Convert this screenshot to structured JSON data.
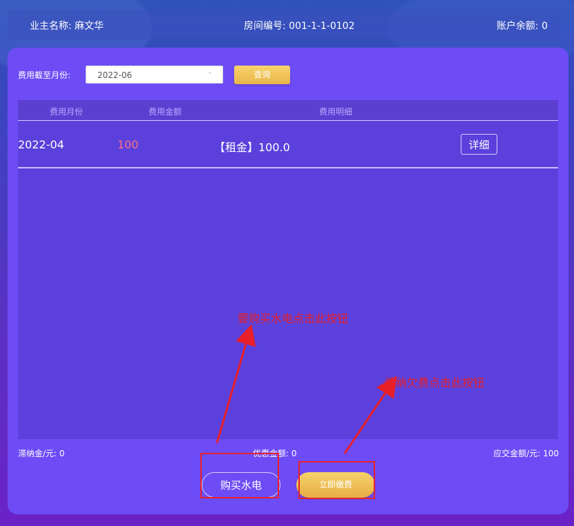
{
  "header": {
    "owner_name": "业主名称: 麻文华",
    "room_number": "房间编号: 001-1-1-0102",
    "account_balance": "账户余额: 0"
  },
  "filter": {
    "label": "费用截至月份:",
    "selected_month": "2022-06",
    "query_label": "查询"
  },
  "table": {
    "columns": [
      "费用月份",
      "费用金额",
      "费用明细"
    ],
    "rows": [
      {
        "month": "2022-04",
        "amount": "100",
        "detail": "【租金】100.0",
        "action_label": "详细"
      }
    ]
  },
  "summary": {
    "late_fee": "滞纳金/元: 0",
    "discount": "优惠金额: 0",
    "amount_due": "应交金额/元: 100"
  },
  "actions": {
    "buy_utilities_label": "购买水电",
    "pay_now_label": "立即缴费"
  },
  "annotations": {
    "buy_hint": "要购买水电点击此按钮",
    "pay_hint": "缴纳欠费点击此按钮"
  },
  "colors": {
    "panel": "#6d4cf5",
    "accent_gold": "#f0c45a",
    "amount_red": "#ff6f8d",
    "annotation_red": "#e8202a"
  }
}
